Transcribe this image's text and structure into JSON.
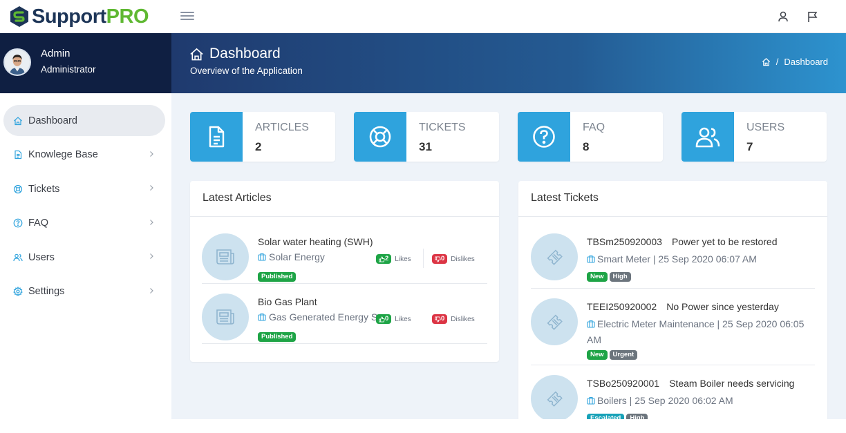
{
  "app": {
    "name_part1": "Support",
    "name_part2": "PRO"
  },
  "user": {
    "name": "Admin",
    "role": "Administrator"
  },
  "menu": [
    {
      "label": "Dashboard",
      "icon": "home-icon",
      "active": true
    },
    {
      "label": "Knowlege Base",
      "icon": "document-icon"
    },
    {
      "label": "Tickets",
      "icon": "lifebuoy-icon"
    },
    {
      "label": "FAQ",
      "icon": "question-icon"
    },
    {
      "label": "Users",
      "icon": "users-icon"
    },
    {
      "label": "Settings",
      "icon": "gear-icon"
    }
  ],
  "header": {
    "title": "Dashboard",
    "subtitle": "Overview of the Application",
    "breadcrumb": "Dashboard",
    "separator": "/"
  },
  "stats": [
    {
      "label": "ARTICLES",
      "value": "2",
      "icon": "document-icon"
    },
    {
      "label": "TICKETS",
      "value": "31",
      "icon": "lifebuoy-icon"
    },
    {
      "label": "FAQ",
      "value": "8",
      "icon": "question-icon"
    },
    {
      "label": "USERS",
      "value": "7",
      "icon": "users-icon"
    }
  ],
  "latest_articles": {
    "title": "Latest Articles",
    "likes_label": "Likes",
    "dislikes_label": "Dislikes",
    "items": [
      {
        "title": "Solar water heating (SWH)",
        "category": "Solar Energy",
        "status": "Published",
        "likes": "2",
        "dislikes": "0"
      },
      {
        "title": "Bio Gas Plant",
        "category": "Gas Generated Energy Source",
        "status": "Published",
        "likes": "0",
        "dislikes": "0"
      }
    ]
  },
  "latest_tickets": {
    "title": "Latest Tickets",
    "items": [
      {
        "id": "TBSm250920003",
        "subject": "Power yet to be restored",
        "meta": "Smart Meter | 25 Sep 2020 06:07 AM",
        "status": "New",
        "priority": "High"
      },
      {
        "id": "TEEI250920002",
        "subject": "No Power since yesterday",
        "meta": "Electric Meter Maintenance | 25 Sep 2020 06:05 AM",
        "status": "New",
        "priority": "Urgent"
      },
      {
        "id": "TSBo250920001",
        "subject": "Steam Boiler needs servicing",
        "meta": "Boilers | 25 Sep 2020 06:02 AM",
        "status": "Escalated",
        "priority": "High"
      }
    ]
  },
  "colors": {
    "accent": "#2fa3dd",
    "sidebar_profile": "#0f1f42",
    "success": "#1ea446",
    "danger": "#dc3545",
    "muted": "#6c757d",
    "info": "#17a2b8"
  }
}
